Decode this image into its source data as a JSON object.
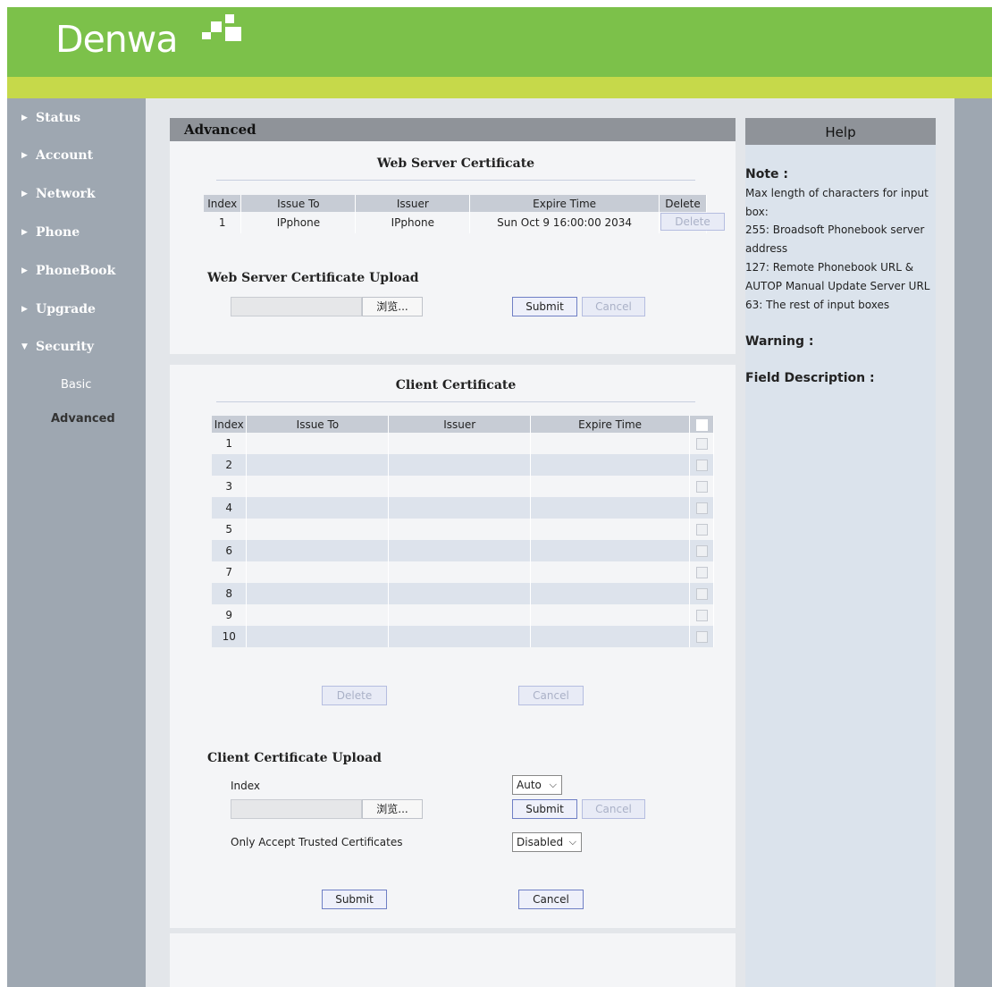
{
  "brand": {
    "logo_text": "Denwa"
  },
  "sidebar": {
    "items": [
      {
        "label": "Status"
      },
      {
        "label": "Account"
      },
      {
        "label": "Network"
      },
      {
        "label": "Phone"
      },
      {
        "label": "PhoneBook"
      },
      {
        "label": "Upgrade"
      },
      {
        "label": "Security"
      }
    ],
    "security_sub": [
      {
        "label": "Basic"
      },
      {
        "label": "Advanced"
      }
    ]
  },
  "main": {
    "title": "Advanced",
    "web_cert": {
      "title": "Web Server Certificate",
      "headers": [
        "Index",
        "Issue To",
        "Issuer",
        "Expire Time",
        "Delete"
      ],
      "row": {
        "index": "1",
        "issue_to": "IPphone",
        "issuer": "IPphone",
        "expire": "Sun Oct 9 16:00:00 2034",
        "delete_label": "Delete"
      }
    },
    "web_upload": {
      "title": "Web Server Certificate Upload",
      "browse_label": "浏览...",
      "submit_label": "Submit",
      "cancel_label": "Cancel"
    },
    "client_cert": {
      "title": "Client Certificate",
      "headers": [
        "Index",
        "Issue To",
        "Issuer",
        "Expire Time"
      ],
      "rows": [
        "1",
        "2",
        "3",
        "4",
        "5",
        "6",
        "7",
        "8",
        "9",
        "10"
      ],
      "delete_label": "Delete",
      "cancel_label": "Cancel"
    },
    "client_upload": {
      "title": "Client Certificate Upload",
      "index_label": "Index",
      "index_value": "Auto",
      "browse_label": "浏览...",
      "submit_label": "Submit",
      "cancel_label": "Cancel",
      "trusted_label": "Only Accept Trusted Certificates",
      "trusted_value": "Disabled"
    },
    "footer": {
      "submit_label": "Submit",
      "cancel_label": "Cancel"
    }
  },
  "help": {
    "title": "Help",
    "note_label": "Note :",
    "note_text": "Max length of characters for input box:",
    "note_lines": [
      "255: Broadsoft Phonebook server address",
      "127: Remote Phonebook URL & AUTOP Manual Update Server URL",
      "63: The rest of input boxes"
    ],
    "warning_label": "Warning :",
    "field_label": "Field Description :"
  },
  "colors": {
    "header": "#7cc14a",
    "stripe": "#c6d94a",
    "sidebar": "#9ea7b1"
  }
}
